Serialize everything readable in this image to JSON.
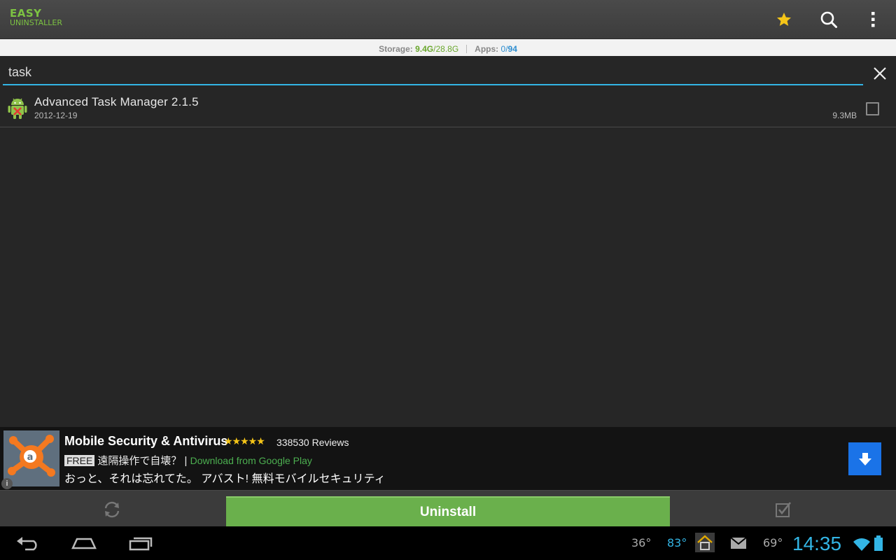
{
  "header": {
    "logo_line1": "EASY",
    "logo_line2": "UNINSTALLER",
    "icons": [
      "star-icon",
      "search-icon",
      "overflow-menu-icon"
    ]
  },
  "storage": {
    "storage_label": "Storage:",
    "storage_used": "9.4G",
    "storage_total": "/28.8G",
    "apps_label": "Apps:",
    "apps_selected": "0",
    "apps_sep": "/",
    "apps_total": "94"
  },
  "search": {
    "value": "task"
  },
  "apps": [
    {
      "name": "Advanced Task Manager 2.1.5",
      "date": "2012-12-19",
      "size": "9.3MB",
      "checked": false
    }
  ],
  "ad": {
    "title": "Mobile Security & Antivirus",
    "stars": "★★★★★",
    "rating": 4.5,
    "reviews": "338530 Reviews",
    "free_badge": "FREE",
    "tagline": "遠隔操作で自壊？ |",
    "cta_text": "Download from Google Play",
    "description": "おっと、それは忘れてた。 アバスト! 無料モバイルセキュリティ",
    "info_label": "i"
  },
  "bottom": {
    "uninstall_label": "Uninstall"
  },
  "statusbar": {
    "temp1": "36°",
    "temp2": "83°",
    "temp3": "69°",
    "time": "14:35"
  },
  "colors": {
    "accent_green": "#6ab04c",
    "accent_blue": "#33b5e5",
    "logo_green": "#7cc242"
  }
}
